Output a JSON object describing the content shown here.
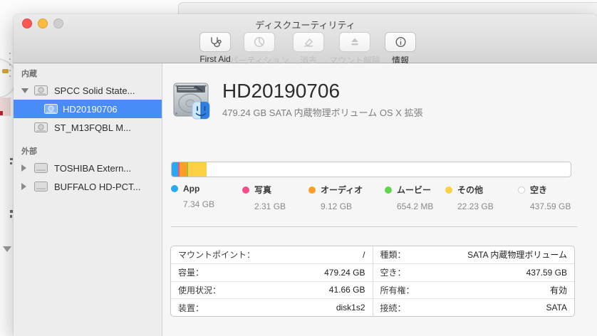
{
  "window": {
    "title": "ディスクユーティリティ",
    "toolbar": {
      "first_aid": "First Aid",
      "partition": "パーティション",
      "erase": "消去",
      "unmount": "マウント解除",
      "info": "情報"
    }
  },
  "sidebar": {
    "section_internal": "内蔵",
    "section_external": "外部",
    "items": [
      {
        "label": "SPCC Solid State..."
      },
      {
        "label": "HD20190706"
      },
      {
        "label": "ST_M13FQBL M..."
      },
      {
        "label": "TOSHIBA Extern..."
      },
      {
        "label": "BUFFALO HD-PCT..."
      }
    ]
  },
  "main": {
    "title": "HD20190706",
    "subtitle": "479.24 GB SATA 内蔵物理ボリューム OS X 拡張",
    "usage": {
      "total_gb": 479.24,
      "segments": [
        {
          "name": "App",
          "value_label": "7.34 GB",
          "gb": 7.34,
          "color": "#28a9f1"
        },
        {
          "name": "写真",
          "value_label": "2.31 GB",
          "gb": 2.31,
          "color": "#f54e87"
        },
        {
          "name": "オーディオ",
          "value_label": "9.12 GB",
          "gb": 9.12,
          "color": "#fa9e27"
        },
        {
          "name": "ムービー",
          "value_label": "654.2 MB",
          "gb": 0.6542,
          "color": "#5fd64c"
        },
        {
          "name": "その他",
          "value_label": "22.23 GB",
          "gb": 22.23,
          "color": "#fbd043"
        },
        {
          "name": "空き",
          "value_label": "437.59 GB",
          "gb": 437.59,
          "color": "#ffffff"
        }
      ]
    },
    "info": {
      "left": [
        {
          "label": "マウントポイント：",
          "value": "/"
        },
        {
          "label": "容量：",
          "value": "479.24 GB"
        },
        {
          "label": "使用状況：",
          "value": "41.66 GB"
        },
        {
          "label": "装置：",
          "value": "disk1s2"
        }
      ],
      "right": [
        {
          "label": "種類：",
          "value": "SATA 内蔵物理ボリューム"
        },
        {
          "label": "空き：",
          "value": "437.59 GB"
        },
        {
          "label": "所有権：",
          "value": "有効"
        },
        {
          "label": "接続：",
          "value": "SATA"
        }
      ]
    }
  }
}
